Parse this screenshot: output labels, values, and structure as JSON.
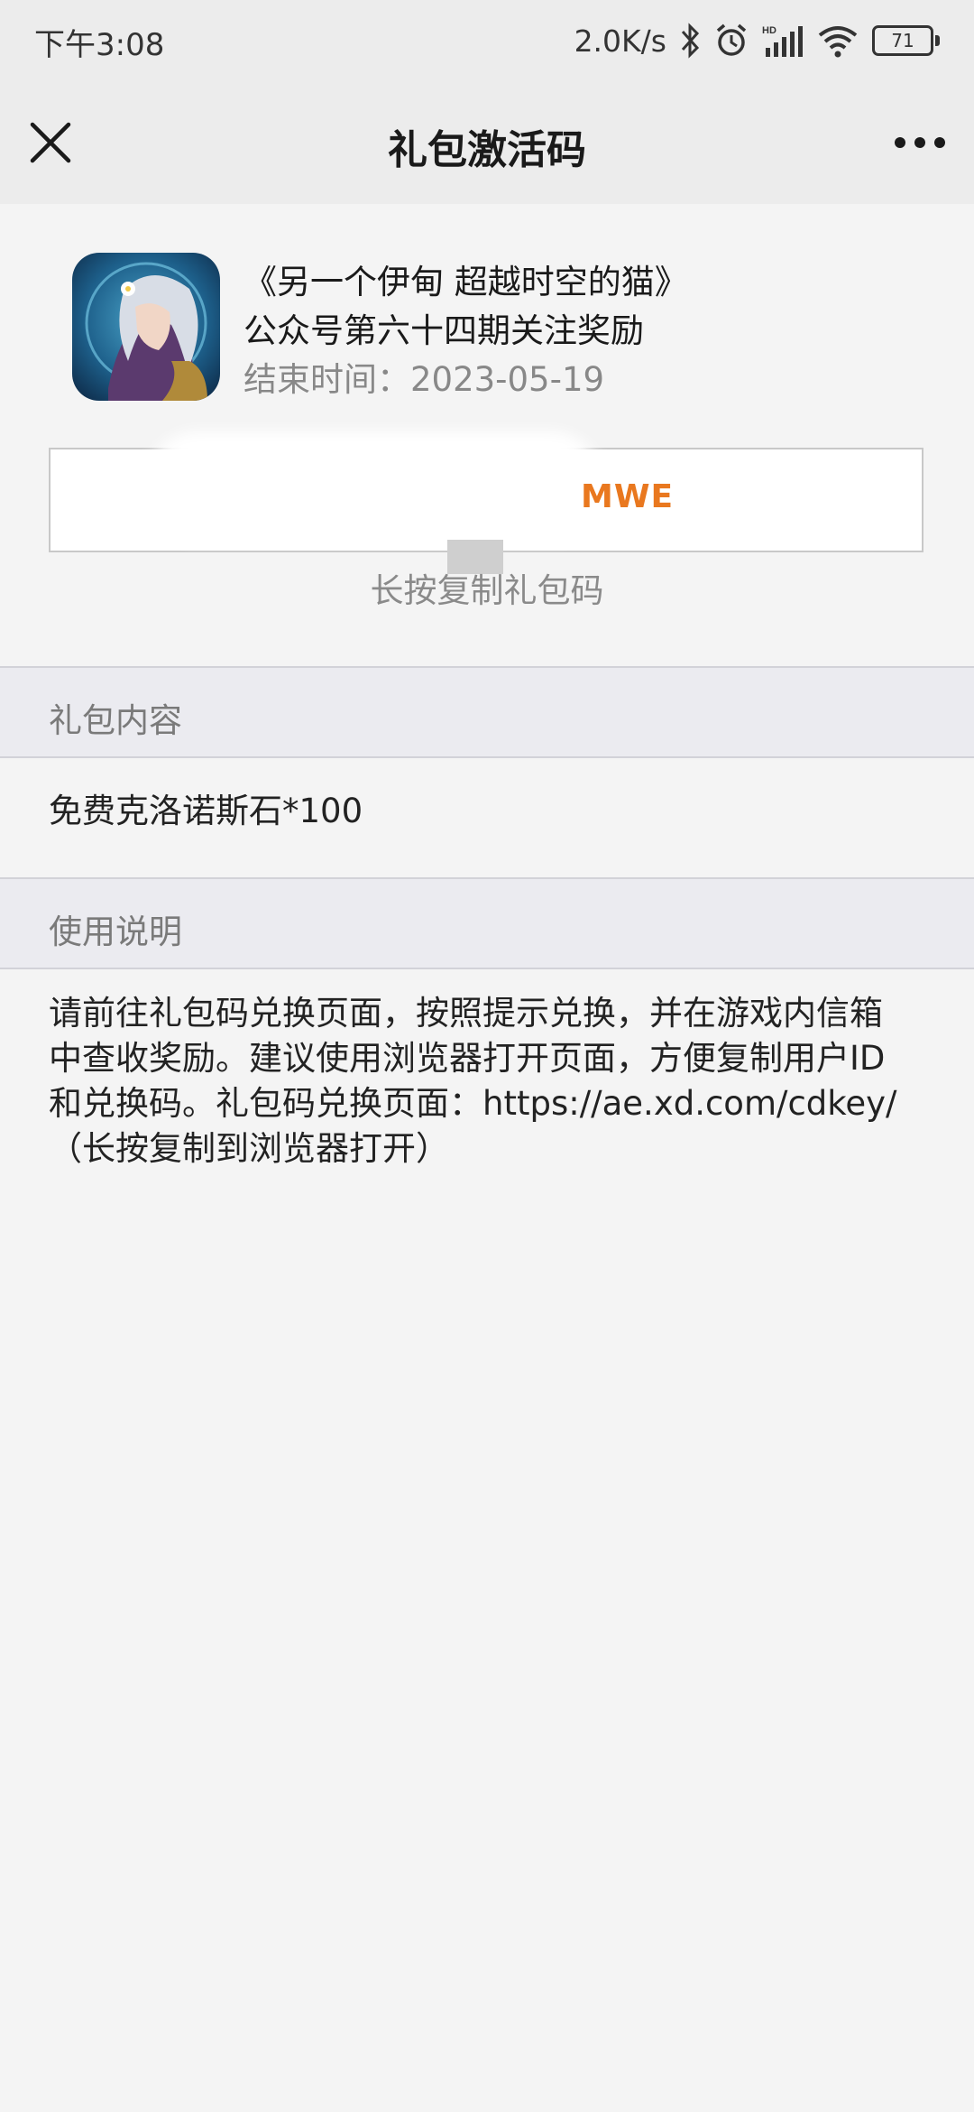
{
  "status_bar": {
    "time": "下午3:08",
    "net_speed": "2.0K/s",
    "battery_level": "71",
    "icons": [
      "bluetooth-icon",
      "alarm-icon",
      "signal-icon",
      "wifi-icon",
      "battery-icon"
    ]
  },
  "nav": {
    "title": "礼包激活码",
    "close_icon": "close-icon",
    "more_icon": "more-icon"
  },
  "game": {
    "title_line1": "《另一个伊甸 超越时空的猫》",
    "title_line2": "公众号第六十四期关注奖励",
    "end_time": "结束时间：2023-05-19"
  },
  "code": {
    "visible_suffix": "MWE",
    "copy_hint": "长按复制礼包码"
  },
  "sections": {
    "content_header": "礼包内容",
    "content_text": "免费克洛诺斯石*100",
    "usage_header": "使用说明",
    "usage_text": "请前往礼包码兑换页面，按照提示兑换，并在游戏内信箱\n中查收奖励。建议使用浏览器打开页面，方便复制用户ID\n和兑换码。礼包码兑换页面：https://ae.xd.com/cdkey/\n（长按复制到浏览器打开）"
  },
  "colors": {
    "code_accent": "#e9781f",
    "background": "#f4f4f4",
    "section_header_bg": "#ebebf0"
  }
}
